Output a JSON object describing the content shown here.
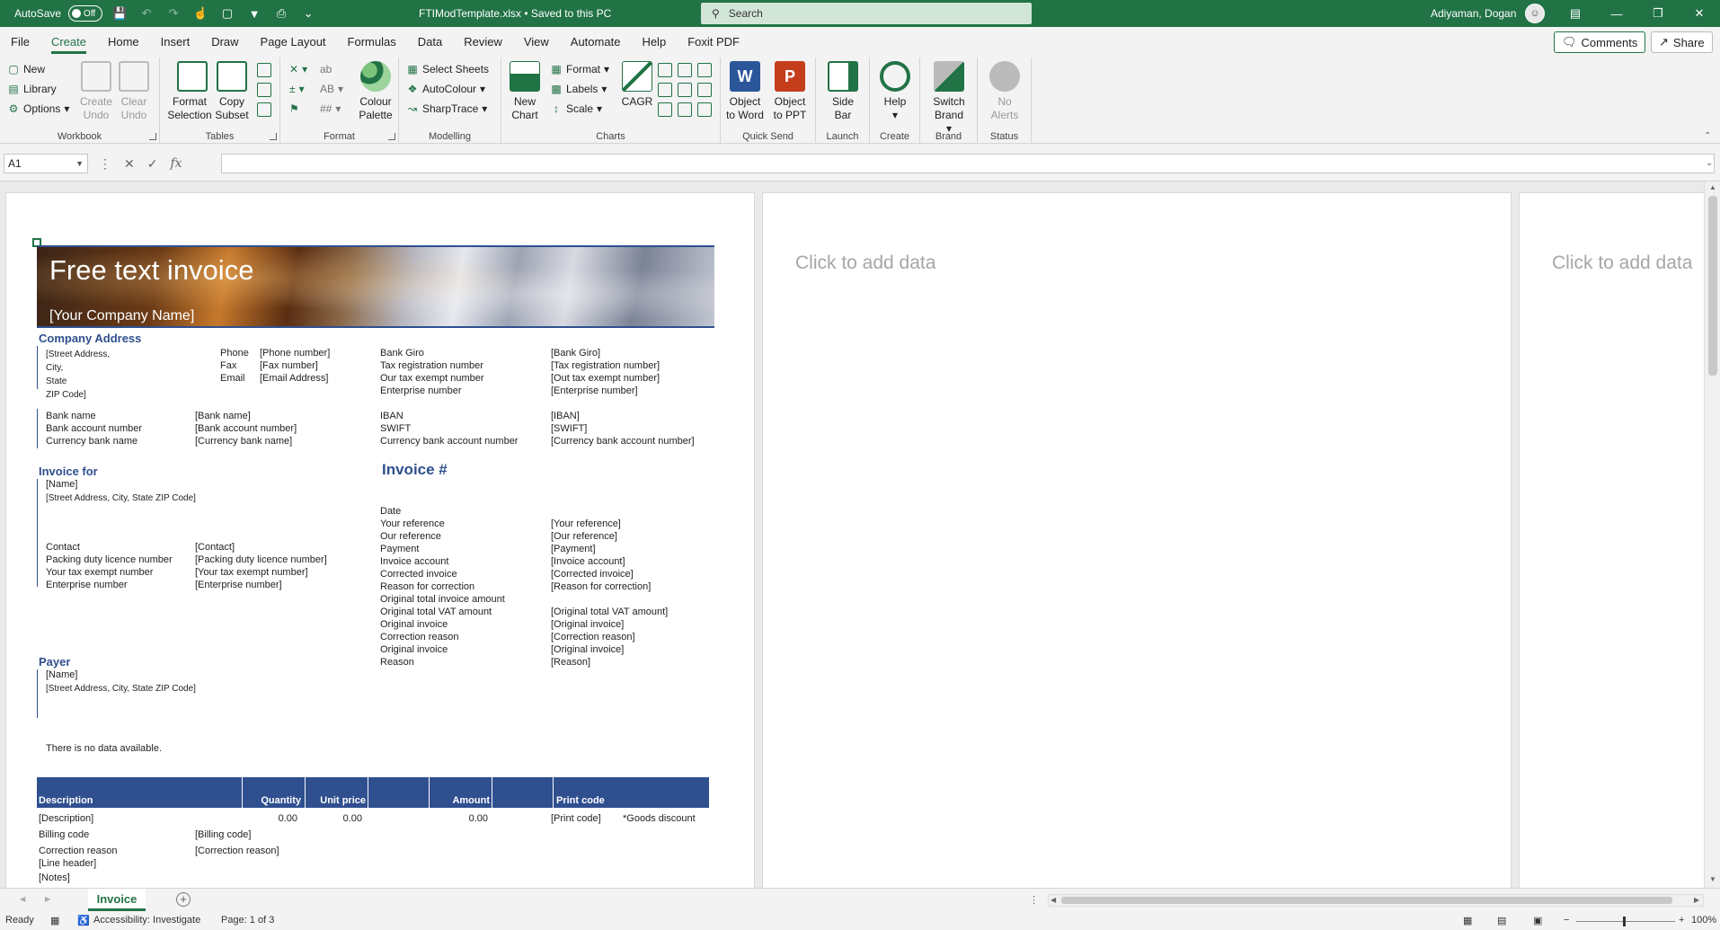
{
  "titlebar": {
    "autosave_label": "AutoSave",
    "autosave_state": "Off",
    "document_title": "FTIModTemplate.xlsx • Saved to this PC",
    "search_placeholder": "Search",
    "user_name": "Adiyaman, Dogan"
  },
  "menu": {
    "tabs": [
      "File",
      "Create",
      "Home",
      "Insert",
      "Draw",
      "Page Layout",
      "Formulas",
      "Data",
      "Review",
      "View",
      "Automate",
      "Help",
      "Foxit PDF"
    ],
    "active": "Create",
    "comments_label": "Comments",
    "share_label": "Share"
  },
  "ribbon": {
    "workbook": {
      "label": "Workbook",
      "new": "New",
      "library": "Library",
      "options": "Options",
      "create_undo": "Create Undo",
      "clear_undo": "Clear Undo"
    },
    "tables": {
      "label": "Tables",
      "format_selection": "Format Selection",
      "copy_subset": "Copy Subset"
    },
    "format": {
      "label": "Format",
      "colour_palette": "Colour Palette"
    },
    "modelling": {
      "label": "Modelling",
      "select_sheets": "Select Sheets",
      "autocolour": "AutoColour",
      "sharptrace": "SharpTrace"
    },
    "charts": {
      "label": "Charts",
      "new_chart": "New Chart",
      "format": "Format",
      "labels": "Labels",
      "scale": "Scale",
      "cagr": "CAGR"
    },
    "quick_send": {
      "label": "Quick Send",
      "object_to_word": "Object to Word",
      "object_to_ppt": "Object to PPT"
    },
    "launch": {
      "label": "Launch",
      "side_bar": "Side Bar"
    },
    "create": {
      "label": "Create",
      "help": "Help"
    },
    "brand": {
      "label": "Brand",
      "switch_brand": "Switch Brand"
    },
    "status": {
      "label": "Status",
      "no_alerts": "No Alerts"
    }
  },
  "formula_bar": {
    "name_box": "A1",
    "formula": ""
  },
  "pages": {
    "placeholder_2": "Click to add data",
    "placeholder_3": "Click to add data"
  },
  "invoice": {
    "title": "Free text invoice",
    "company_name": "[Your Company Name]",
    "company_address_heading": "Company Address",
    "address_lines": [
      "[Street Address,",
      "City,",
      "State",
      "ZIP Code]"
    ],
    "contact_labels": [
      "Phone",
      "Fax",
      "Email"
    ],
    "contact_values": [
      "[Phone number]",
      "[Fax number]",
      "[Email Address]"
    ],
    "tax_labels": [
      "Bank Giro",
      "Tax registration number",
      "Our tax exempt number",
      "Enterprise number"
    ],
    "tax_values": [
      "[Bank Giro]",
      "[Tax registration number]",
      "[Out tax exempt number]",
      "[Enterprise number]"
    ],
    "bank_labels": [
      "Bank name",
      "Bank account number",
      "Currency bank name"
    ],
    "bank_values": [
      "[Bank name]",
      "[Bank account number]",
      "[Currency bank name]"
    ],
    "iban_labels": [
      "IBAN",
      "SWIFT",
      "Currency bank account number"
    ],
    "iban_values": [
      "[IBAN]",
      "[SWIFT]",
      "[Currency bank account number]"
    ],
    "invoice_for_heading": "Invoice for",
    "invoice_for_name": "[Name]",
    "invoice_for_address": "[Street Address, City, State ZIP Code]",
    "customer_labels": [
      "Contact",
      "Packing duty licence number",
      "Your tax exempt number",
      "Enterprise number"
    ],
    "customer_values": [
      "[Contact]",
      "[Packing duty licence number]",
      "[Your tax exempt number]",
      "[Enterprise number]"
    ],
    "invoice_number_heading": "Invoice #",
    "detail_labels": [
      "Date",
      "Your reference",
      "Our reference",
      "Payment",
      "Invoice account",
      "Corrected invoice",
      "Reason for correction",
      "Original total invoice amount",
      "Original total VAT amount",
      "Original invoice",
      "Correction reason",
      "Original invoice",
      "Reason"
    ],
    "detail_values": [
      "",
      "[Your reference]",
      "[Our reference]",
      "[Payment]",
      "[Invoice account]",
      "[Corrected invoice]",
      "[Reason for correction]",
      "",
      "[Original total VAT amount]",
      "[Original invoice]",
      "[Correction reason]",
      "[Original invoice]",
      "[Reason]"
    ],
    "payer_heading": "Payer",
    "payer_name": "[Name]",
    "payer_address": "[Street Address, City, State ZIP Code]",
    "no_data": "There is no data available.",
    "table_headers": [
      "Description",
      "Quantity",
      "Unit price",
      "",
      "Amount",
      "",
      "Print code"
    ],
    "row_description": "[Description]",
    "row_quantity": "0.00",
    "row_unit_price": "0.00",
    "row_amount": "0.00",
    "row_print_code": "[Print code]",
    "row_goods_discount": "*Goods discount",
    "billing_code_label": "Billing code",
    "billing_code_value": "[Billing code]",
    "correction_reason_label": "Correction reason",
    "correction_reason_value": "[Correction reason]",
    "line_header": "[Line header]",
    "notes": "[Notes]"
  },
  "sheet_tabs": {
    "active": "Invoice"
  },
  "statusbar": {
    "ready": "Ready",
    "accessibility": "Accessibility: Investigate",
    "page": "Page: 1 of 3",
    "zoom": "100%"
  },
  "colors": {
    "accent": "#217346",
    "invoice_blue": "#2f4f8f"
  }
}
